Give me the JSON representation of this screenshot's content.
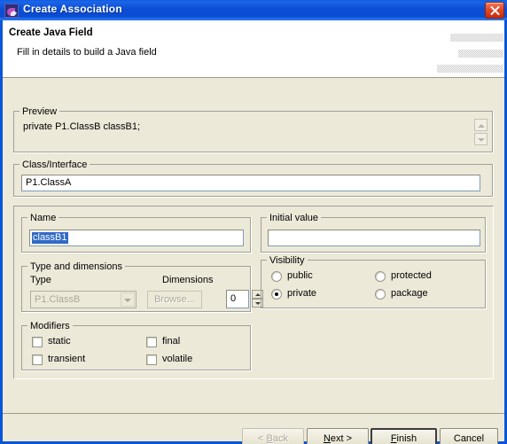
{
  "window": {
    "title": "Create Association",
    "icon": "eclipse-app-icon",
    "close_label": "Close"
  },
  "header": {
    "title": "Create Java Field",
    "subtitle": "Fill in details to build a Java field",
    "banner_placeholder": "dithered-banner-graphic"
  },
  "preview": {
    "legend": "Preview",
    "text": "private P1.ClassB classB1;",
    "scroll_up_icon": "scroll-up-arrow-icon",
    "scroll_down_icon": "scroll-down-arrow-icon"
  },
  "class_interface": {
    "legend": "Class/Interface",
    "value": "P1.ClassA"
  },
  "name": {
    "legend": "Name",
    "value": "classB1",
    "selected": true
  },
  "initial_value": {
    "legend": "Initial value",
    "value": "",
    "placeholder": ""
  },
  "type_and_dimensions": {
    "legend": "Type and dimensions",
    "type_label": "Type",
    "type_value": "P1.ClassB",
    "type_disabled": true,
    "browse_label": "Browse...",
    "browse_disabled": true,
    "dimensions_label": "Dimensions",
    "dimensions_value": "0",
    "spinner_up_icon": "spinner-up-arrow-icon",
    "spinner_down_icon": "spinner-down-arrow-icon"
  },
  "visibility": {
    "legend": "Visibility",
    "selected": "private",
    "options": [
      {
        "label": "public",
        "checked": false
      },
      {
        "label": "protected",
        "checked": false
      },
      {
        "label": "private",
        "checked": true
      },
      {
        "label": "package",
        "checked": false
      }
    ]
  },
  "modifiers": {
    "legend": "Modifiers",
    "options": [
      {
        "label": "static",
        "checked": false
      },
      {
        "label": "final",
        "checked": false
      },
      {
        "label": "transient",
        "checked": false
      },
      {
        "label": "volatile",
        "checked": false
      }
    ]
  },
  "buttons": {
    "back": {
      "prefix": "< ",
      "mnemonic": "B",
      "suffix": "ack",
      "disabled": true
    },
    "next": {
      "prefix": "",
      "mnemonic": "N",
      "suffix": "ext >",
      "disabled": false
    },
    "finish": {
      "prefix": "",
      "mnemonic": "F",
      "suffix": "inish",
      "disabled": false,
      "default": true
    },
    "cancel": {
      "label": "Cancel",
      "disabled": false
    }
  },
  "colors": {
    "titlebar_blue": "#0A4BD2",
    "dialog_face": "#ECE9D8",
    "selection_blue": "#316AC5",
    "close_red": "#C32A10",
    "disabled_text": "#ACA899",
    "group_border": "#A0A09A"
  }
}
